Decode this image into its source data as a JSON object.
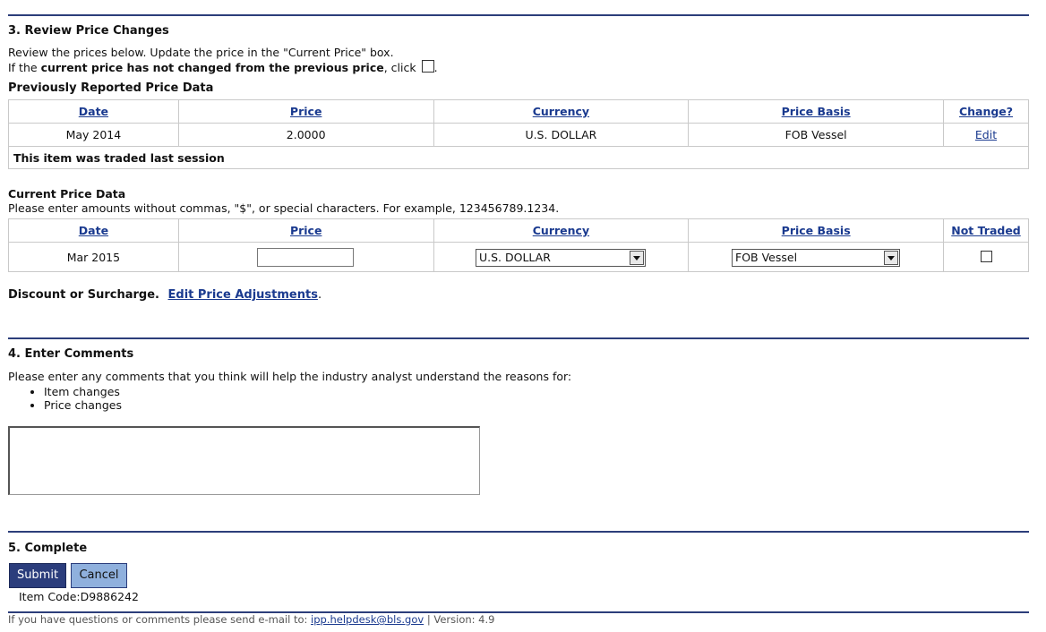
{
  "review": {
    "title": "3. Review Price Changes",
    "intro_line1": "Review the prices below. Update the price in the \"Current Price\" box.",
    "intro_pre": "If the ",
    "intro_bold": "current price has not changed from the previous price",
    "intro_post": ", click",
    "intro_end": ".",
    "previous_heading": "Previously Reported Price Data",
    "previous_table": {
      "headers": [
        "Date",
        "Price",
        "Currency",
        "Price Basis",
        "Change?"
      ],
      "row": {
        "date": "May 2014",
        "price": "2.0000",
        "currency": "U.S. DOLLAR",
        "basis": "FOB Vessel",
        "action": "Edit"
      },
      "note": "This item was traded last session"
    },
    "current_heading": "Current Price Data",
    "current_instructions": "Please enter amounts without commas, \"$\", or special characters. For example, 123456789.1234.",
    "current_table": {
      "headers": [
        "Date",
        "Price",
        "Currency",
        "Price Basis",
        "Not Traded"
      ],
      "row": {
        "date": "Mar 2015",
        "price_value": "",
        "currency_selected": "U.S. DOLLAR",
        "basis_selected": "FOB Vessel"
      }
    },
    "discount_label": "Discount or Surcharge.",
    "discount_link": "Edit Price Adjustments",
    "discount_end": "."
  },
  "comments": {
    "title": "4. Enter Comments",
    "prompt": "Please enter any comments that you think will help the industry analyst understand the reasons for:",
    "bullets": [
      "Item changes",
      "Price changes"
    ],
    "value": ""
  },
  "complete": {
    "title": "5. Complete",
    "submit_label": "Submit",
    "cancel_label": "Cancel",
    "item_code": "Item Code:D9886242"
  },
  "footer": {
    "text_pre": "If you have questions or comments please send e-mail to: ",
    "email": "ipp.helpdesk@bls.gov",
    "version": " | Version: 4.9"
  },
  "colors": {
    "rule": "#2c3e7a",
    "link": "#1a3a8f",
    "submit_bg": "#2b3d7c",
    "cancel_bg": "#8fb0dd"
  }
}
